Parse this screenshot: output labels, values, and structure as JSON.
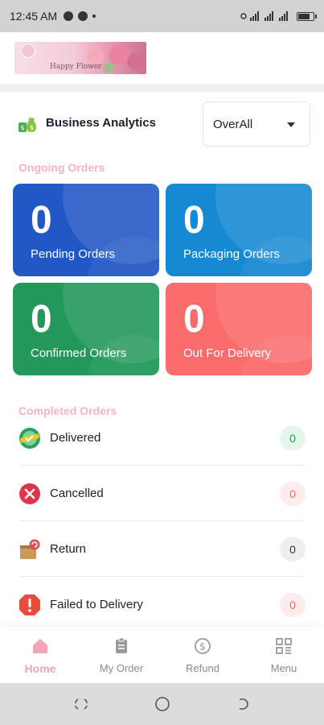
{
  "status_bar": {
    "time": "12:45 AM"
  },
  "header": {
    "logo_text": "Happy Flower"
  },
  "analytics": {
    "title": "Business Analytics",
    "filter": "OverAll"
  },
  "ongoing": {
    "title": "Ongoing Orders",
    "cards": [
      {
        "value": "0",
        "label": "Pending Orders",
        "color": "#2258c6"
      },
      {
        "value": "0",
        "label": "Packaging Orders",
        "color": "#1789d2"
      },
      {
        "value": "0",
        "label": "Confirmed Orders",
        "color": "#23985a"
      },
      {
        "value": "0",
        "label": "Out For Delivery",
        "color": "#fa6b6b"
      }
    ]
  },
  "completed": {
    "title": "Completed Orders",
    "items": [
      {
        "label": "Delivered",
        "count": "0",
        "icon": "delivered-badge-icon"
      },
      {
        "label": "Cancelled",
        "count": "0",
        "icon": "cancel-icon"
      },
      {
        "label": "Return",
        "count": "0",
        "icon": "return-box-icon"
      },
      {
        "label": "Failed to Delivery",
        "count": "0",
        "icon": "alert-icon"
      }
    ]
  },
  "bottom_nav": {
    "items": [
      {
        "label": "Home",
        "icon": "home-icon",
        "active": true
      },
      {
        "label": "My Order",
        "icon": "order-icon"
      },
      {
        "label": "Refund",
        "icon": "refund-icon"
      },
      {
        "label": "Menu",
        "icon": "menu-icon"
      }
    ]
  },
  "colors": {
    "accent": "#f5a3b8",
    "section_title": "#f5b3c6"
  }
}
